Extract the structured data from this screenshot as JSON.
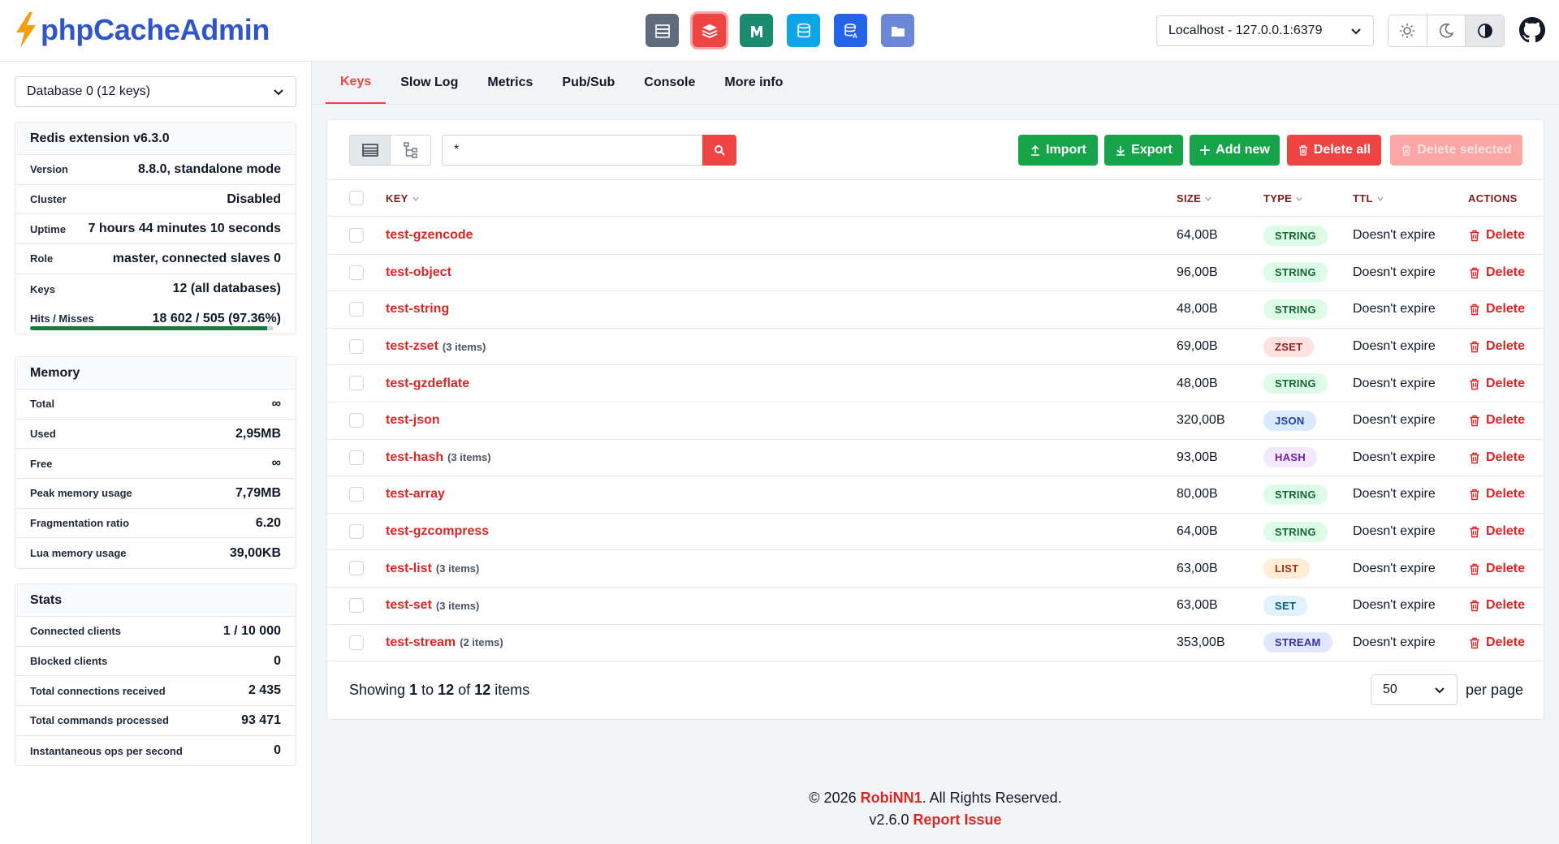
{
  "app": {
    "title": "phpCacheAdmin",
    "accent": "#ef4444",
    "brand_color": "#2f55c8"
  },
  "cache_switcher": [
    {
      "name": "server-icon",
      "color": "#5f6b7a"
    },
    {
      "name": "redis-icon",
      "color": "#ef4444",
      "active": true
    },
    {
      "name": "memcached-icon",
      "color": "#1a8b6e"
    },
    {
      "name": "opcache-icon",
      "color": "#0ea5e9"
    },
    {
      "name": "apcu-icon",
      "color": "#2563eb"
    },
    {
      "name": "file-cache-icon",
      "color": "#6b86d6"
    }
  ],
  "server": {
    "selected": "Localhost - 127.0.0.1:6379"
  },
  "sidebar": {
    "database": "Database 0 (12 keys)",
    "info_panel": {
      "title": "Redis extension v6.3.0",
      "rows": [
        {
          "label": "Version",
          "value": "8.8.0, standalone mode"
        },
        {
          "label": "Cluster",
          "value": "Disabled"
        },
        {
          "label": "Uptime",
          "value": "7 hours 44 minutes 10 seconds"
        },
        {
          "label": "Role",
          "value": "master, connected slaves 0"
        },
        {
          "label": "Keys",
          "value": "12 (all databases)"
        }
      ],
      "hits": {
        "label": "Hits / Misses",
        "value": "18 602 / 505 (97.36%)",
        "ratio": 0.9736
      }
    },
    "memory_panel": {
      "title": "Memory",
      "rows": [
        {
          "label": "Total",
          "value": "∞"
        },
        {
          "label": "Used",
          "value": "2,95MB"
        },
        {
          "label": "Free",
          "value": "∞"
        },
        {
          "label": "Peak memory usage",
          "value": "7,79MB"
        },
        {
          "label": "Fragmentation ratio",
          "value": "6.20"
        },
        {
          "label": "Lua memory usage",
          "value": "39,00KB"
        }
      ]
    },
    "stats_panel": {
      "title": "Stats",
      "rows": [
        {
          "label": "Connected clients",
          "value": "1 / 10 000"
        },
        {
          "label": "Blocked clients",
          "value": "0"
        },
        {
          "label": "Total connections received",
          "value": "2 435"
        },
        {
          "label": "Total commands processed",
          "value": "93 471"
        },
        {
          "label": "Instantaneous ops per second",
          "value": "0"
        }
      ]
    }
  },
  "tabs": [
    "Keys",
    "Slow Log",
    "Metrics",
    "Pub/Sub",
    "Console",
    "More info"
  ],
  "active_tab": 0,
  "toolbar": {
    "search_value": "*",
    "import_label": "Import",
    "export_label": "Export",
    "add_label": "Add new",
    "delete_all_label": "Delete all",
    "delete_selected_label": "Delete selected"
  },
  "table": {
    "headers": {
      "key": "KEY",
      "size": "SIZE",
      "type": "TYPE",
      "ttl": "TTL",
      "actions": "ACTIONS"
    },
    "delete_label": "Delete",
    "rows": [
      {
        "key": "test-gzencode",
        "count": "",
        "size": "64,00B",
        "type": "STRING",
        "ttl": "Doesn't expire"
      },
      {
        "key": "test-object",
        "count": "",
        "size": "96,00B",
        "type": "STRING",
        "ttl": "Doesn't expire"
      },
      {
        "key": "test-string",
        "count": "",
        "size": "48,00B",
        "type": "STRING",
        "ttl": "Doesn't expire"
      },
      {
        "key": "test-zset",
        "count": "(3 items)",
        "size": "69,00B",
        "type": "ZSET",
        "ttl": "Doesn't expire"
      },
      {
        "key": "test-gzdeflate",
        "count": "",
        "size": "48,00B",
        "type": "STRING",
        "ttl": "Doesn't expire"
      },
      {
        "key": "test-json",
        "count": "",
        "size": "320,00B",
        "type": "JSON",
        "ttl": "Doesn't expire"
      },
      {
        "key": "test-hash",
        "count": "(3 items)",
        "size": "93,00B",
        "type": "HASH",
        "ttl": "Doesn't expire"
      },
      {
        "key": "test-array",
        "count": "",
        "size": "80,00B",
        "type": "STRING",
        "ttl": "Doesn't expire"
      },
      {
        "key": "test-gzcompress",
        "count": "",
        "size": "64,00B",
        "type": "STRING",
        "ttl": "Doesn't expire"
      },
      {
        "key": "test-list",
        "count": "(3 items)",
        "size": "63,00B",
        "type": "LIST",
        "ttl": "Doesn't expire"
      },
      {
        "key": "test-set",
        "count": "(3 items)",
        "size": "63,00B",
        "type": "SET",
        "ttl": "Doesn't expire"
      },
      {
        "key": "test-stream",
        "count": "(2 items)",
        "size": "353,00B",
        "type": "STREAM",
        "ttl": "Doesn't expire"
      }
    ],
    "type_colors": {
      "STRING": {
        "bg": "#dcfce7",
        "fg": "#166534"
      },
      "ZSET": {
        "bg": "#fee2e2",
        "fg": "#991b1b"
      },
      "JSON": {
        "bg": "#dbeafe",
        "fg": "#1e40af"
      },
      "HASH": {
        "bg": "#f3e8ff",
        "fg": "#6b21a8"
      },
      "LIST": {
        "bg": "#ffedd5",
        "fg": "#9a3412"
      },
      "SET": {
        "bg": "#e0f2fe",
        "fg": "#075985"
      },
      "STREAM": {
        "bg": "#e0e7ff",
        "fg": "#3730a3"
      }
    }
  },
  "pagination": {
    "prefix": "Showing",
    "from": "1",
    "to_word": "to",
    "to": "12",
    "of_word": "of",
    "total": "12",
    "suffix": "items",
    "per_page": "50",
    "per_page_label": "per page"
  },
  "footer": {
    "copyright": "© 2026",
    "author": "RobiNN1",
    "rights": ". All Rights Reserved.",
    "version": "v2.6.0",
    "report": "Report Issue"
  }
}
